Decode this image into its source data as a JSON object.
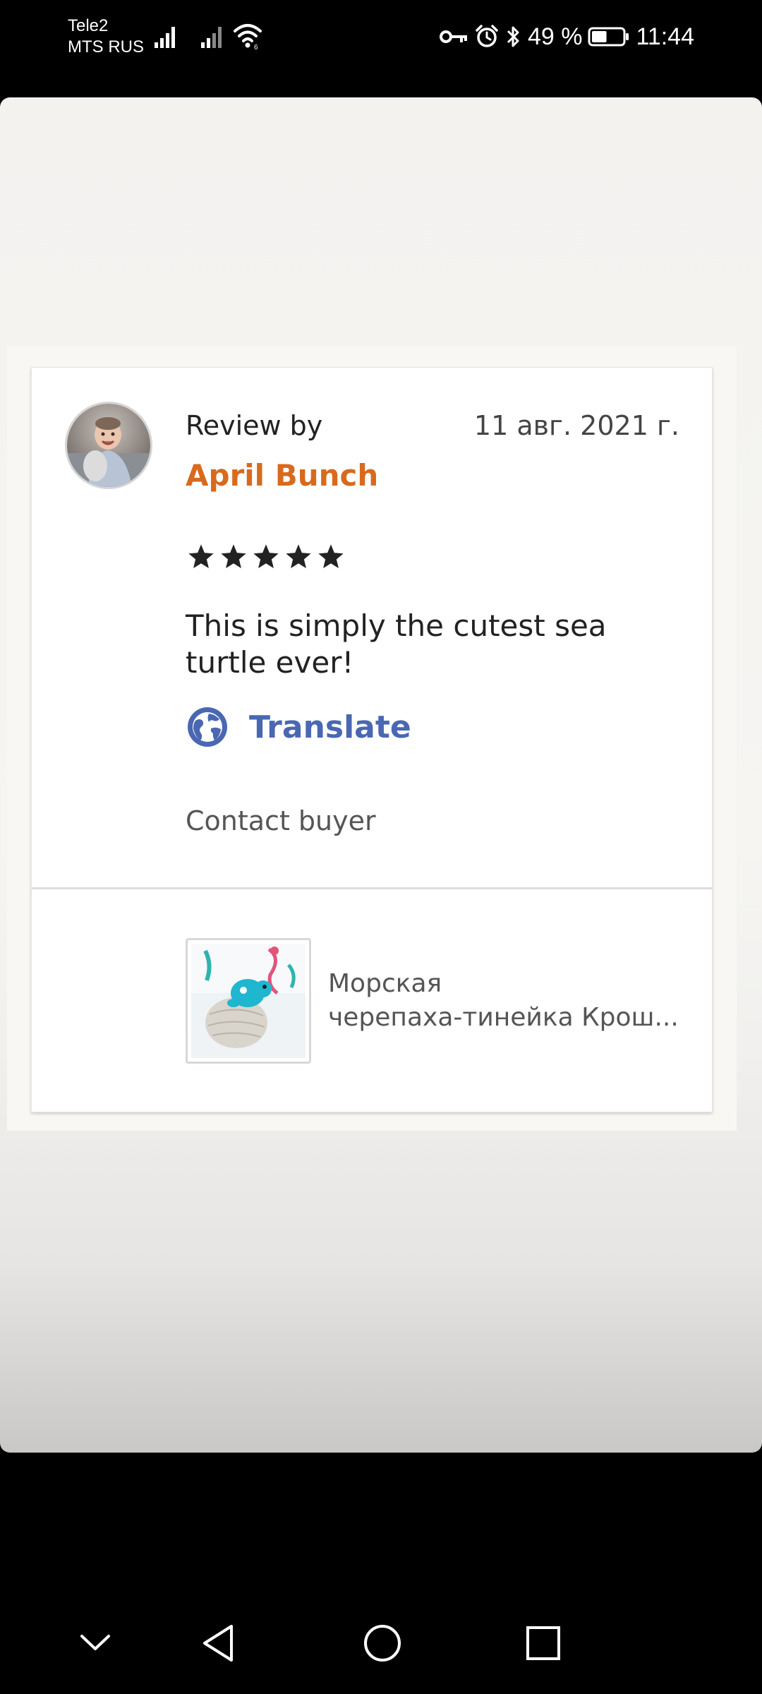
{
  "status_bar": {
    "carrier_1": "Tele2",
    "carrier_2": "MTS RUS",
    "battery": "49 %",
    "battery_level": 0.49,
    "time": "11:44",
    "icons": [
      "signal-icon",
      "signal-icon",
      "wifi-icon",
      "key-icon",
      "alarm-icon",
      "bluetooth-icon",
      "battery-icon"
    ]
  },
  "review": {
    "review_by_label": "Review by",
    "reviewer_name": "April Bunch",
    "date": "11 авг. 2021 г.",
    "rating": 5,
    "rating_max": 5,
    "text": "This is simply the cutest sea turtle ever!",
    "translate_label": "Translate",
    "contact_label": "Contact buyer"
  },
  "listing": {
    "title_line_1": "Морская",
    "title_line_2": "черепаха-тинейка Крош..."
  },
  "nav": {
    "icons": [
      "chevron-down-icon",
      "back-icon",
      "home-icon",
      "recents-icon"
    ]
  },
  "colors": {
    "reviewer_name": "#d86a1e",
    "translate": "#4a67b2",
    "stars": "#222222"
  }
}
